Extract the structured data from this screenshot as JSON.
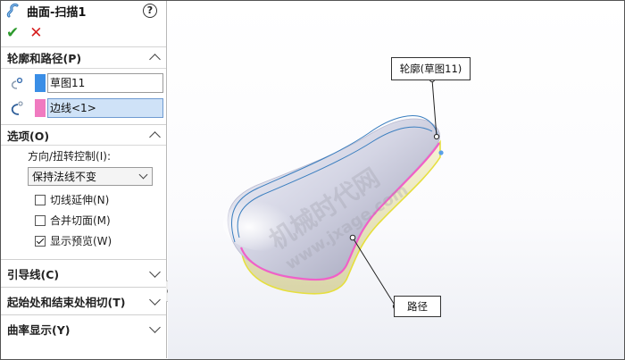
{
  "panel": {
    "title": "曲面-扫描1",
    "help_symbol": "?",
    "ok_symbol": "✔",
    "cancel_symbol": "✕",
    "sections": {
      "profile_path": {
        "label": "轮廓和路径(P)",
        "profile_value": "草图11",
        "path_value": "边线<1>",
        "profile_color": "#3a8ee6",
        "path_color": "#f07ac0"
      },
      "options": {
        "label": "选项(O)",
        "orientation_label": "方向/扭转控制(I):",
        "orientation_value": "保持法线不变",
        "checkboxes": [
          {
            "label": "切线延伸(N)",
            "checked": false
          },
          {
            "label": "合并切面(M)",
            "checked": false
          },
          {
            "label": "显示预览(W)",
            "checked": true
          }
        ]
      },
      "guide_curves": {
        "label": "引导线(C)"
      },
      "start_end_tangency": {
        "label": "起始处和结束处相切(T)"
      },
      "curvature_display": {
        "label": "曲率显示(Y)"
      }
    }
  },
  "viewport": {
    "callout_profile": "轮廓(草图11)",
    "callout_path": "路径",
    "watermark_line1": "机械时代网",
    "watermark_line2": "www.jxage.com",
    "colors": {
      "surface": "#c8c8d8",
      "path_edge": "#f060c8",
      "profile_edge": "#3a7ebf",
      "yellow_edge": "#e8e24a"
    }
  }
}
